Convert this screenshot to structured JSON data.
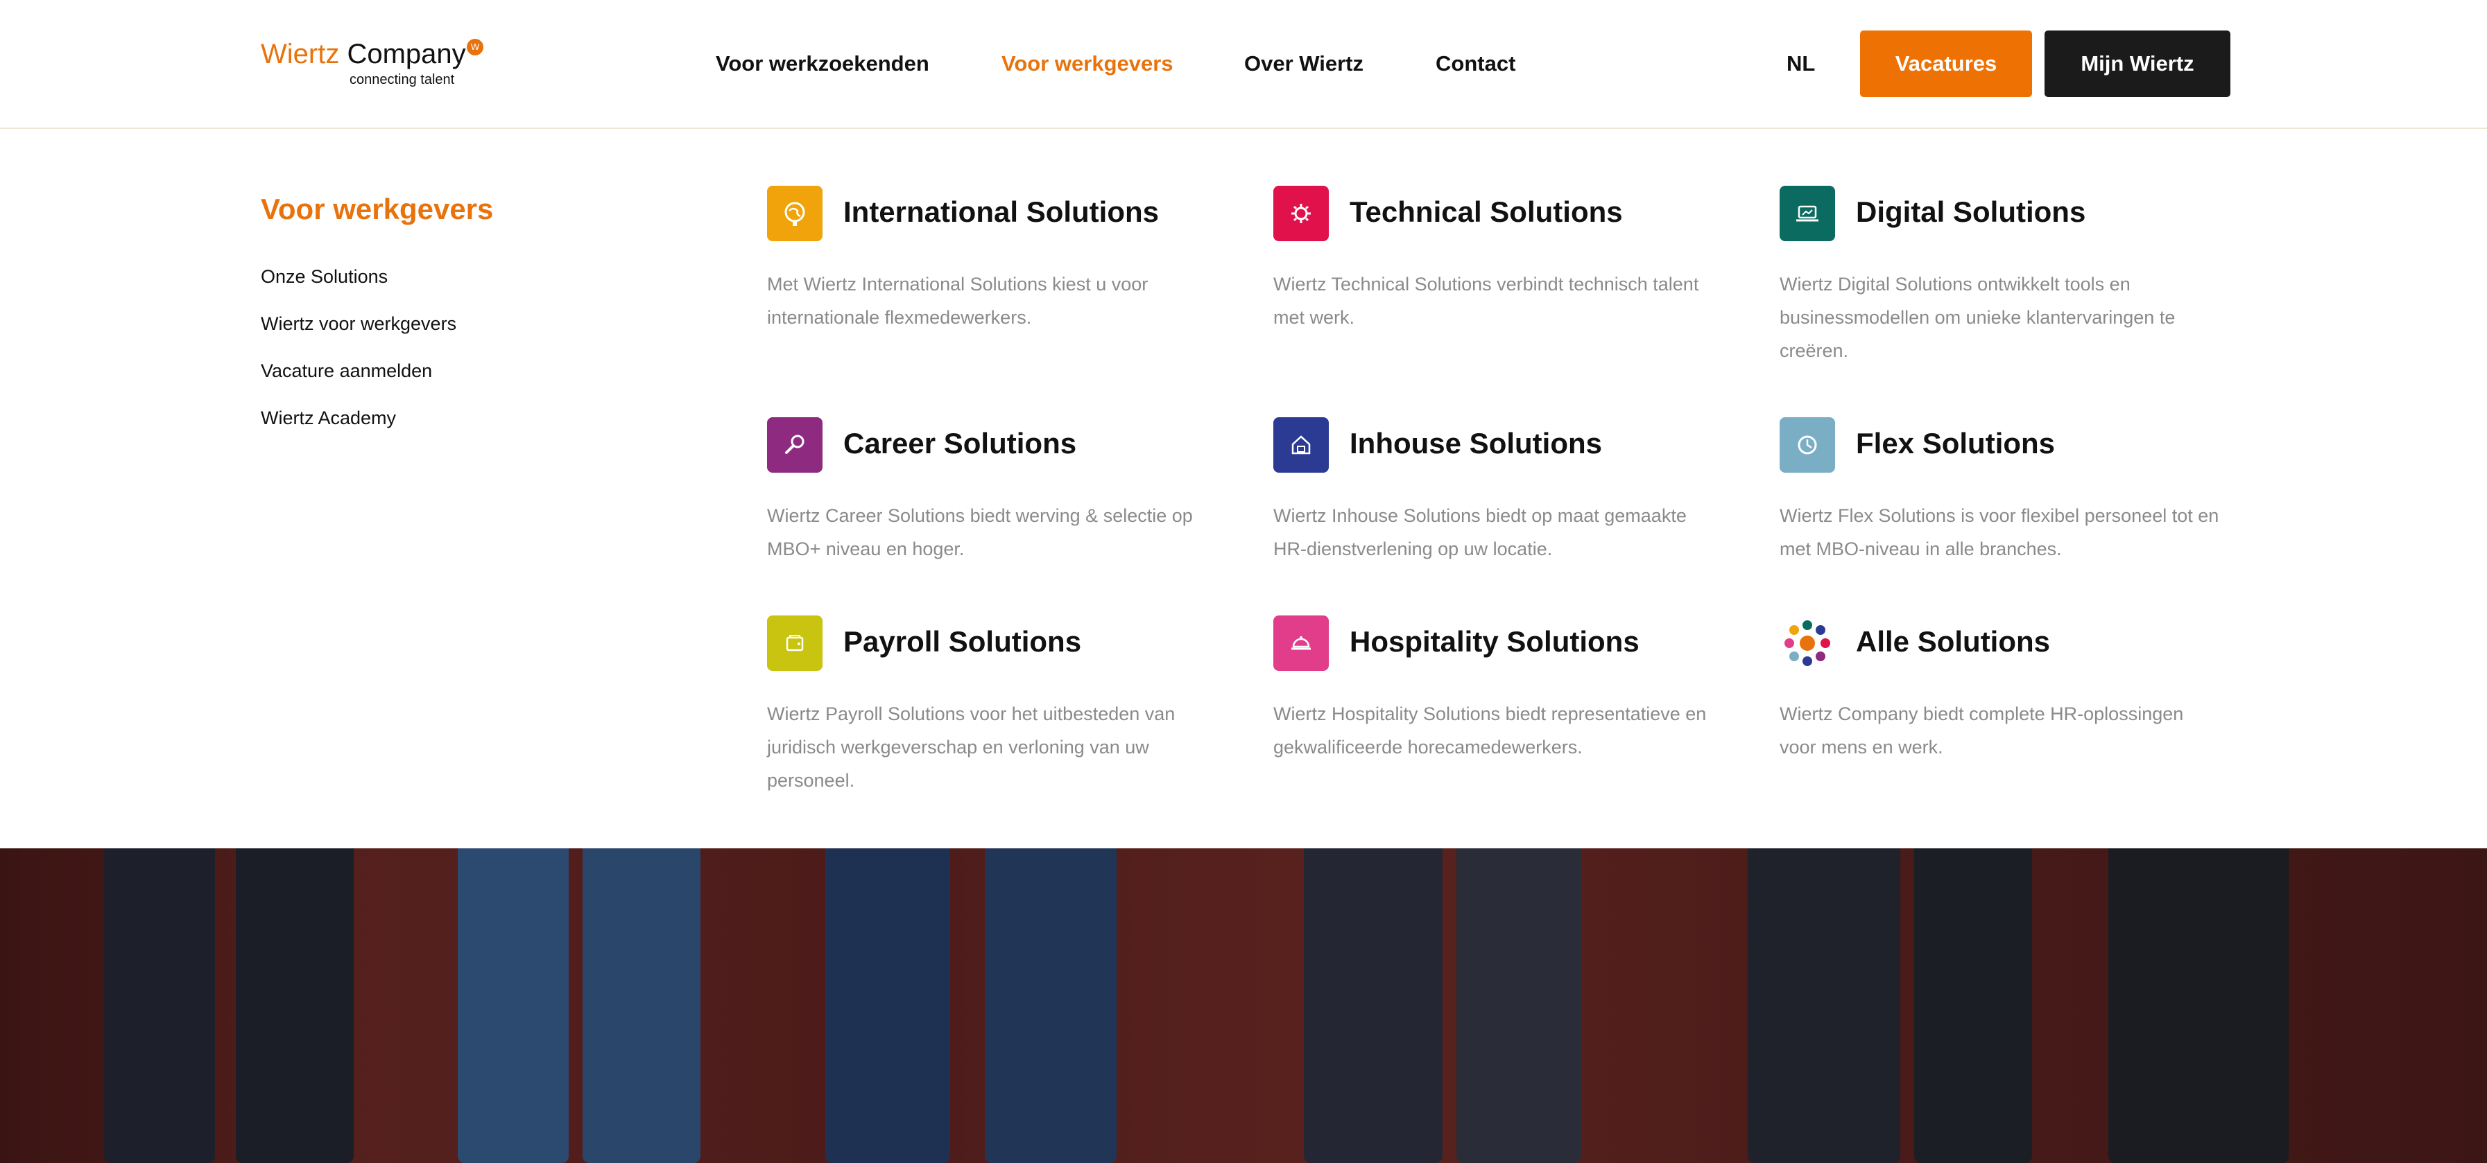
{
  "logo": {
    "word1": "Wiertz",
    "word2": "Company",
    "badge": "W",
    "tagline": "connecting talent"
  },
  "nav": {
    "items": [
      {
        "label": "Voor werkzoekenden",
        "active": false
      },
      {
        "label": "Voor werkgevers",
        "active": true
      },
      {
        "label": "Over Wiertz",
        "active": false
      },
      {
        "label": "Contact",
        "active": false
      }
    ],
    "language": "NL",
    "vacatures_button": "Vacatures",
    "mijn_wiertz_button": "Mijn Wiertz"
  },
  "menu": {
    "title": "Voor werkgevers",
    "links": [
      "Onze Solutions",
      "Wiertz voor werkgevers",
      "Vacature aanmelden",
      "Wiertz Academy"
    ],
    "solutions": [
      {
        "title": "International Solutions",
        "description": "Met Wiertz International Solutions kiest u voor internationale flexmedewerkers.",
        "icon": "globe-icon",
        "color": "#f0a30a"
      },
      {
        "title": "Technical Solutions",
        "description": "Wiertz Technical Solutions verbindt technisch talent met werk.",
        "icon": "gear-icon",
        "color": "#e0114b"
      },
      {
        "title": "Digital Solutions",
        "description": "Wiertz Digital Solutions ontwikkelt tools en businessmodellen om unieke klantervaringen te creëren.",
        "icon": "laptop-icon",
        "color": "#0c6b60"
      },
      {
        "title": "Career Solutions",
        "description": "Wiertz Career Solutions biedt werving & selectie op MBO+ niveau en hoger.",
        "icon": "magnifier-icon",
        "color": "#8e2a7f"
      },
      {
        "title": "Inhouse Solutions",
        "description": "Wiertz Inhouse Solutions biedt op maat gemaakte HR-dienstverlening op uw locatie.",
        "icon": "house-icon",
        "color": "#2b3b93"
      },
      {
        "title": "Flex Solutions",
        "description": "Wiertz Flex Solutions is voor flexibel personeel tot en met MBO-niveau in alle branches.",
        "icon": "clock-icon",
        "color": "#7aaec4"
      },
      {
        "title": "Payroll Solutions",
        "description": "Wiertz Payroll Solutions voor het uitbesteden van juridisch werkgeverschap en verloning van uw personeel.",
        "icon": "wallet-icon",
        "color": "#c8c40f"
      },
      {
        "title": "Hospitality Solutions",
        "description": "Wiertz Hospitality Solutions biedt representatieve en gekwalificeerde horecamedewerkers.",
        "icon": "cloche-icon",
        "color": "#e23d8a"
      },
      {
        "title": "Alle Solutions",
        "description": "Wiertz Company biedt complete HR-oplossingen voor mens en werk.",
        "icon": "dots-cluster-icon",
        "color": "#e8730c"
      }
    ]
  },
  "colors": {
    "accent": "#e8730c",
    "vacatures_bg": "#ee7203",
    "dark_button_bg": "#1b1b1b",
    "description_text": "#8a8a8a"
  }
}
